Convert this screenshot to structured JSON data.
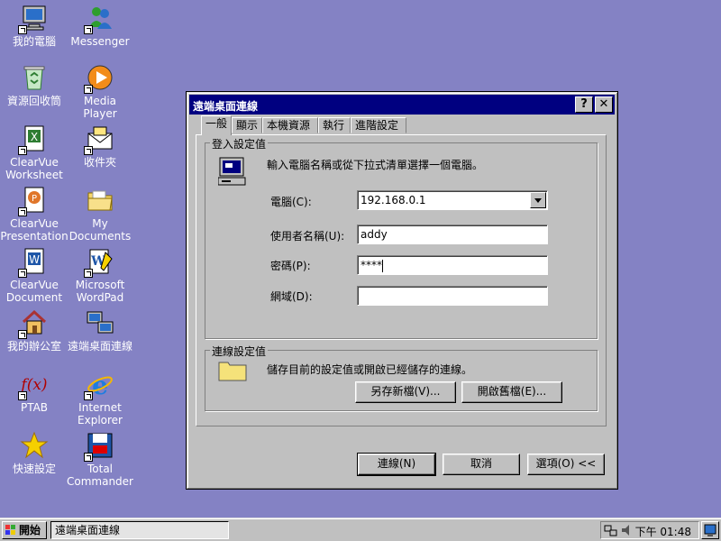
{
  "desktop": {
    "icons": [
      {
        "label": "我的電腦"
      },
      {
        "label": "Messenger"
      },
      {
        "label": "資源回收筒"
      },
      {
        "label": "Media Player"
      },
      {
        "label": "ClearVue Worksheet"
      },
      {
        "label": "收件夾"
      },
      {
        "label": "ClearVue Presentation"
      },
      {
        "label": "My Documents"
      },
      {
        "label": "ClearVue Document"
      },
      {
        "label": "Microsoft WordPad"
      },
      {
        "label": "我的辦公室"
      },
      {
        "label": "遠端桌面連線"
      },
      {
        "label": "PTAB"
      },
      {
        "label": "Internet Explorer"
      },
      {
        "label": "快速設定"
      },
      {
        "label": "Total Commander"
      }
    ]
  },
  "dialog": {
    "title": "遠端桌面連線",
    "help_label": "?",
    "close_label": "✕",
    "tabs": [
      {
        "label": "一般"
      },
      {
        "label": "顯示"
      },
      {
        "label": "本機資源"
      },
      {
        "label": "執行"
      },
      {
        "label": "進階設定"
      }
    ],
    "login_group": {
      "title": "登入設定值",
      "instruction": "輸入電腦名稱或從下拉式清單選擇一個電腦。",
      "computer_label": "電腦(C):",
      "computer_value": "192.168.0.1",
      "username_label": "使用者名稱(U):",
      "username_value": "addy",
      "password_label": "密碼(P):",
      "password_value": "****",
      "domain_label": "網域(D):",
      "domain_value": ""
    },
    "connection_group": {
      "title": "連線設定值",
      "instruction": "儲存目前的設定值或開啟已經儲存的連線。",
      "save_as_label": "另存新檔(V)...",
      "open_label": "開啟舊檔(E)..."
    },
    "connect_label": "連線(N)",
    "cancel_label": "取消",
    "options_label": "選項(O) <<"
  },
  "taskbar": {
    "start_label": "開始",
    "task_label": "遠端桌面連線",
    "clock": "下午 01:48"
  },
  "colors": {
    "desktop": "#8482c4",
    "titlebar": "#000080",
    "face": "#c0c0c0"
  }
}
